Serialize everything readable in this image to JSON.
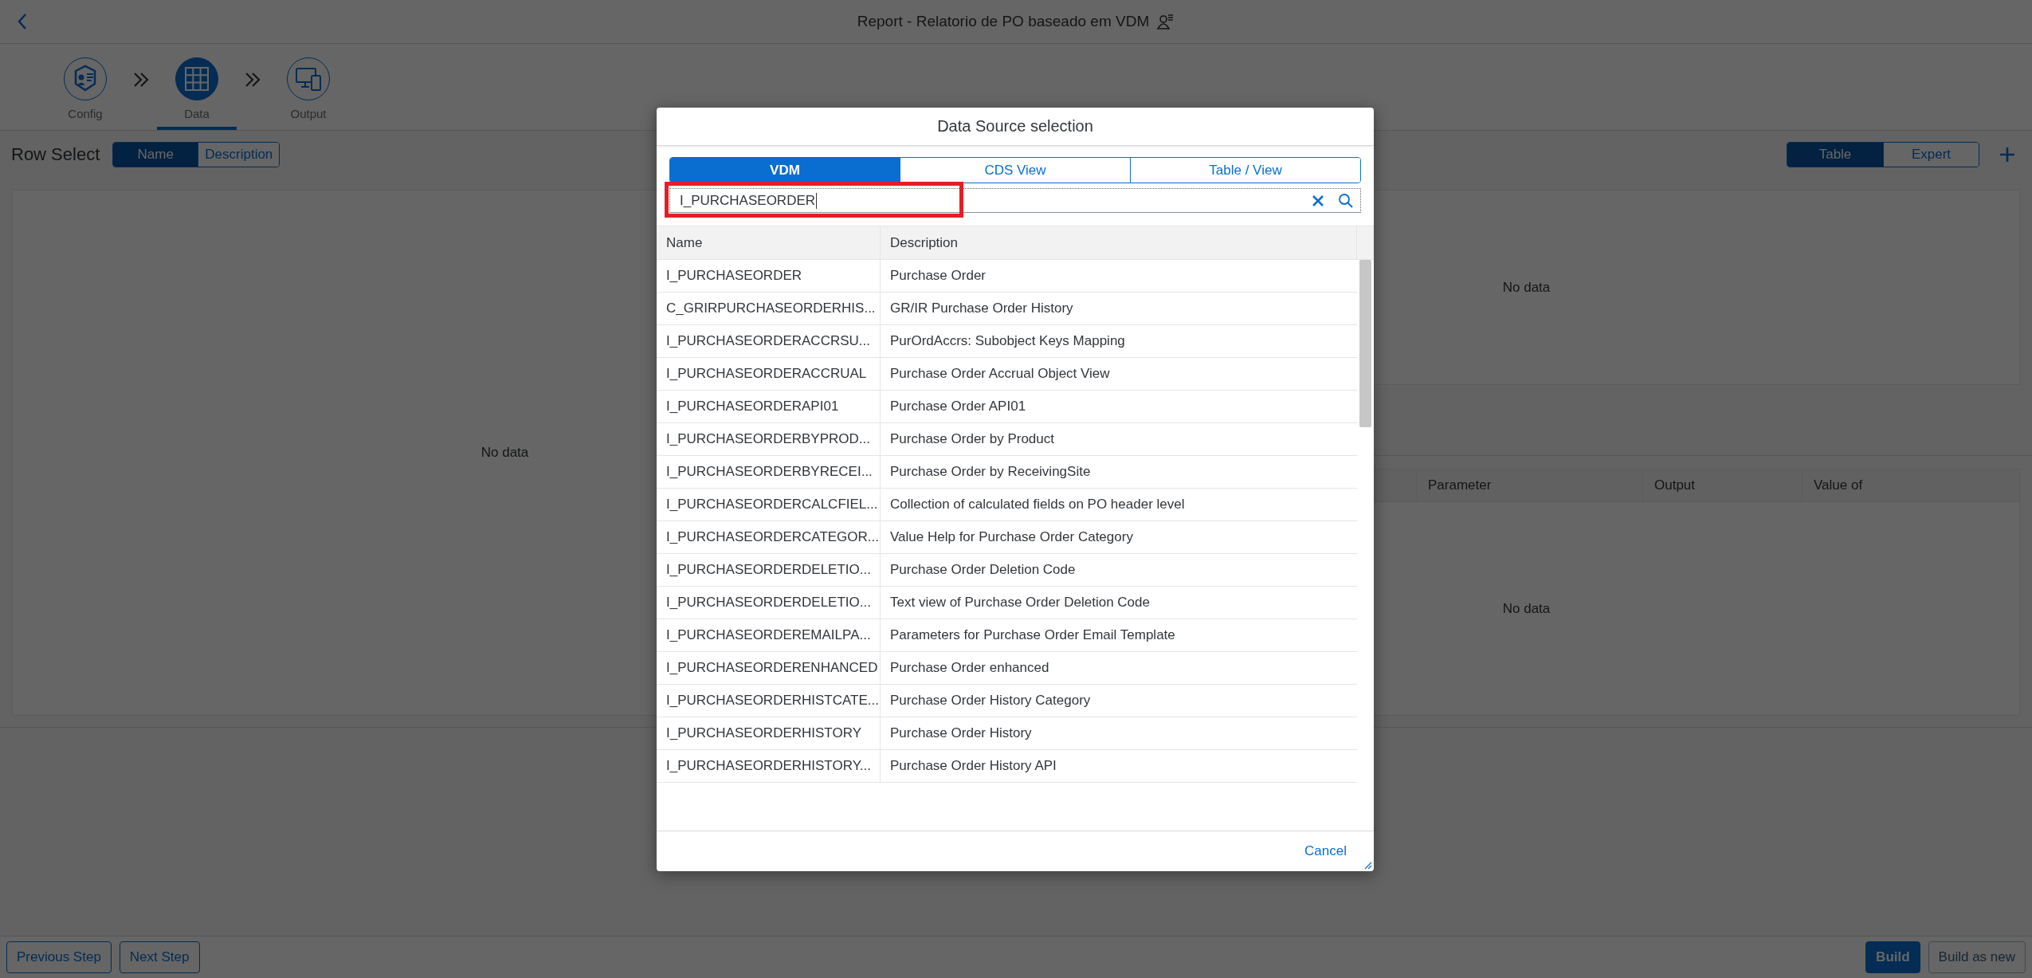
{
  "header": {
    "title": "Report - Relatorio de PO baseado em VDM"
  },
  "steps": [
    {
      "label": "Config",
      "kind": "config",
      "selected": false
    },
    {
      "label": "Data",
      "kind": "data",
      "selected": true
    },
    {
      "label": "Output",
      "kind": "output",
      "selected": false
    }
  ],
  "toolbar": {
    "title": "Row Select",
    "row_select": [
      {
        "label": "Name",
        "selected": true
      },
      {
        "label": "Description",
        "selected": false
      }
    ],
    "view_toggle": [
      {
        "label": "Table",
        "selected": true
      },
      {
        "label": "Expert",
        "selected": false
      }
    ]
  },
  "left_panel": {
    "empty_text": "No data"
  },
  "right_top_panel": {
    "empty_text": "No data"
  },
  "parameter_table": {
    "columns": [
      "Parameter",
      "Output",
      "Value of"
    ],
    "empty_text": "No data"
  },
  "dialog": {
    "title": "Data Source selection",
    "tabs": [
      {
        "label": "VDM",
        "selected": true
      },
      {
        "label": "CDS View",
        "selected": false
      },
      {
        "label": "Table / View",
        "selected": false
      }
    ],
    "search": {
      "value": "I_PURCHASEORDER",
      "highlighted": true
    },
    "columns": [
      "Name",
      "Description"
    ],
    "rows": [
      {
        "name": "I_PURCHASEORDER",
        "description": "Purchase Order"
      },
      {
        "name": "C_GRIRPURCHASEORDERHIS...",
        "description": "GR/IR Purchase Order History"
      },
      {
        "name": "I_PURCHASEORDERACCRSU...",
        "description": "PurOrdAccrs: Subobject Keys Mapping"
      },
      {
        "name": "I_PURCHASEORDERACCRUAL",
        "description": "Purchase Order Accrual Object View"
      },
      {
        "name": "I_PURCHASEORDERAPI01",
        "description": "Purchase Order API01"
      },
      {
        "name": "I_PURCHASEORDERBYPROD...",
        "description": "Purchase Order by Product"
      },
      {
        "name": "I_PURCHASEORDERBYRECEI...",
        "description": "Purchase Order by ReceivingSite"
      },
      {
        "name": "I_PURCHASEORDERCALCFIEL...",
        "description": "Collection of calculated fields on PO header level"
      },
      {
        "name": "I_PURCHASEORDERCATEGOR...",
        "description": "Value Help for Purchase Order Category"
      },
      {
        "name": "I_PURCHASEORDERDELETIO...",
        "description": "Purchase Order Deletion Code"
      },
      {
        "name": "I_PURCHASEORDERDELETIO...",
        "description": "Text view of Purchase Order Deletion Code"
      },
      {
        "name": "I_PURCHASEORDEREMAILPA...",
        "description": "Parameters for Purchase Order Email Template"
      },
      {
        "name": "I_PURCHASEORDERENHANCED",
        "description": "Purchase Order enhanced"
      },
      {
        "name": "I_PURCHASEORDERHISTCATE...",
        "description": "Purchase Order History Category"
      },
      {
        "name": "I_PURCHASEORDERHISTORY",
        "description": "Purchase Order History"
      },
      {
        "name": "I_PURCHASEORDERHISTORY...",
        "description": "Purchase Order History API"
      }
    ],
    "cancel": "Cancel"
  },
  "footer": {
    "left_buttons": [
      {
        "label": "Previous Step",
        "disabled": false
      },
      {
        "label": "Next Step",
        "disabled": false
      }
    ],
    "right_buttons": [
      {
        "label": "Build",
        "kind": "emphasized",
        "disabled": false
      },
      {
        "label": "Build as new",
        "kind": "default",
        "disabled": true
      }
    ]
  }
}
